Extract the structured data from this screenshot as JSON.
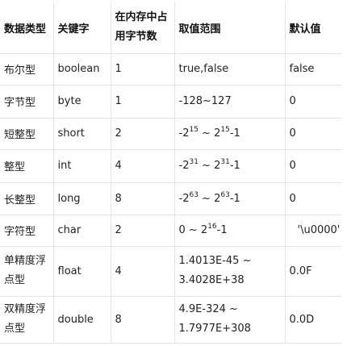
{
  "table": {
    "headers": [
      "数据类型",
      "关键字",
      "在内存中占用字节数",
      "取值范围",
      "默认值"
    ],
    "rows": [
      {
        "type": "布尔型",
        "keyword": "boolean",
        "bytes": "1",
        "range": "true,false",
        "default": "false"
      },
      {
        "type": "字节型",
        "keyword": "byte",
        "bytes": "1",
        "range": "-128~127",
        "default": "0"
      },
      {
        "type": "短整型",
        "keyword": "short",
        "bytes": "2",
        "range_base": "-2",
        "range_exp1": "15",
        "range_mid": " ~ 2",
        "range_exp2": "15",
        "range_tail": "-1",
        "default": "0"
      },
      {
        "type": "整型",
        "keyword": "int",
        "bytes": "4",
        "range_base": "-2",
        "range_exp1": "31",
        "range_mid": " ~ 2",
        "range_exp2": "31",
        "range_tail": "-1",
        "default": "0"
      },
      {
        "type": "长整型",
        "keyword": "long",
        "bytes": "8",
        "range_base": "-2",
        "range_exp1": "63",
        "range_mid": " ~ 2",
        "range_exp2": "63",
        "range_tail": "-1",
        "default": "0"
      },
      {
        "type": "字符型",
        "keyword": "char",
        "bytes": "2",
        "range_base": "0 ~ 2",
        "range_exp": "16",
        "range_tail": "-1",
        "default": "'\\u0000'"
      },
      {
        "type": "单精度浮点型",
        "keyword": "float",
        "bytes": "4",
        "range": "1.4013E-45 ~ 3.4028E+38",
        "default": "0.0F"
      },
      {
        "type": "双精度浮点型",
        "keyword": "double",
        "bytes": "8",
        "range": "4.9E-324 ~ 1.7977E+308",
        "default": "0.0D"
      }
    ]
  }
}
